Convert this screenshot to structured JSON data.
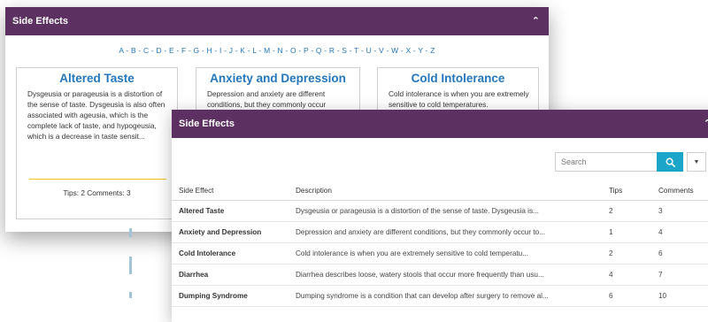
{
  "back_panel": {
    "title": "Side Effects",
    "alphabet": "A - B - C - D - E - F - G - H - I - J - K - L - M - N - O - P - Q - R - S - T - U - V - W - X - Y - Z",
    "cards": [
      {
        "title": "Altered Taste",
        "description": "Dysgeusia or parageusia is a distortion of the sense of taste. Dysgeusia is also often associated with ageusia, which is the complete lack of taste, and hypogeusia, which is a decrease in taste sensit...",
        "stats": "Tips: 2 Comments: 3"
      },
      {
        "title": "Anxiety and Depression",
        "description": "Depression and anxiety are different conditions, but they commonly occur",
        "stats": ""
      },
      {
        "title": "Cold Intolerance",
        "description": "Cold intolerance is when you are extremely sensitive to cold temperatures.",
        "stats": ""
      }
    ]
  },
  "front_panel": {
    "title": "Side Effects",
    "search": {
      "placeholder": "Search"
    },
    "columns": [
      "Side Effect",
      "Description",
      "Tips",
      "Comments"
    ],
    "rows": [
      {
        "name": "Altered Taste",
        "description": "Dysgeusia or parageusia is a distortion of the sense of taste. Dysgeusia is...",
        "tips": "2",
        "comments": "3"
      },
      {
        "name": "Anxiety and Depression",
        "description": "Depression and anxiety are different conditions, but they commonly occur to...",
        "tips": "1",
        "comments": "4"
      },
      {
        "name": "Cold Intolerance",
        "description": "Cold intolerance is when you are extremely sensitive to cold temperatu...",
        "tips": "2",
        "comments": "6"
      },
      {
        "name": "Diarrhea",
        "description": "Diarrhea describes loose, watery stools that occur more frequently than usu...",
        "tips": "4",
        "comments": "7"
      },
      {
        "name": "Dumping Syndrome",
        "description": "Dumping syndrome is a condition that can develop after surgery to remove al...",
        "tips": "6",
        "comments": "10"
      }
    ]
  },
  "colors": {
    "header": "#5c3162",
    "link": "#2377bd",
    "search_button": "#1ba6c9",
    "divider": "#f2c21b"
  },
  "icons": {
    "collapse": "chevron-up-icon",
    "search": "search-icon",
    "dropdown": "caret-down-icon"
  }
}
